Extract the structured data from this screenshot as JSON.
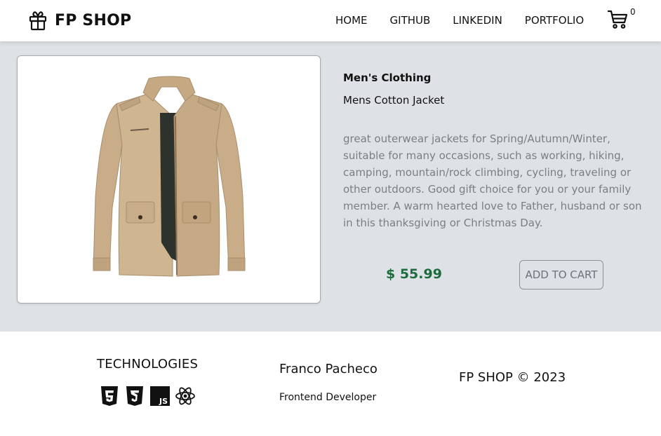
{
  "navbar": {
    "brand": "FP SHOP",
    "brand_icon": "gift-icon",
    "links": [
      "HOME",
      "GITHUB",
      "LINKEDIN",
      "PORTFOLIO"
    ],
    "cart_icon": "cart-icon",
    "cart_count": "0"
  },
  "product": {
    "category": "Men's Clothing",
    "title": "Mens Cotton Jacket",
    "description": "great outerwear jackets for Spring/Autumn/Winter, suitable for many occasions, such as working, hiking, camping, mountain/rock climbing, cycling, traveling or other outdoors. Good gift choice for you or your family member. A warm hearted love to Father, husband or son in this thanksgiving or Christmas Day.",
    "price": "$ 55.99",
    "add_to_cart": "ADD TO CART",
    "image": "beige-cotton-jacket"
  },
  "footer": {
    "technologies_title": "TECHNOLOGIES",
    "tech_icons": [
      "html5-icon",
      "css3-icon",
      "javascript-icon",
      "react-icon"
    ],
    "js_label": "JS",
    "author_name": "Franco Pacheco",
    "author_role": "Frontend Developer",
    "copyright": "FP SHOP © 2023"
  },
  "colors": {
    "main_bg": "#dee2e6",
    "price": "#1e6b3c",
    "description": "#7b7f84"
  }
}
